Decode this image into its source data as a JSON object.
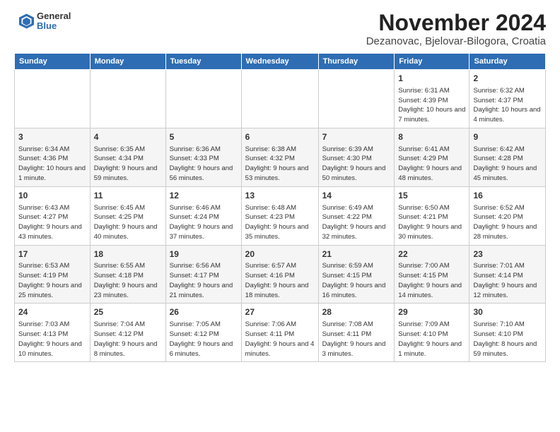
{
  "logo": {
    "line1": "General",
    "line2": "Blue"
  },
  "title": "November 2024",
  "location": "Dezanovac, Bjelovar-Bilogora, Croatia",
  "days_of_week": [
    "Sunday",
    "Monday",
    "Tuesday",
    "Wednesday",
    "Thursday",
    "Friday",
    "Saturday"
  ],
  "weeks": [
    [
      {
        "day": "",
        "text": ""
      },
      {
        "day": "",
        "text": ""
      },
      {
        "day": "",
        "text": ""
      },
      {
        "day": "",
        "text": ""
      },
      {
        "day": "",
        "text": ""
      },
      {
        "day": "1",
        "text": "Sunrise: 6:31 AM\nSunset: 4:39 PM\nDaylight: 10 hours and 7 minutes."
      },
      {
        "day": "2",
        "text": "Sunrise: 6:32 AM\nSunset: 4:37 PM\nDaylight: 10 hours and 4 minutes."
      }
    ],
    [
      {
        "day": "3",
        "text": "Sunrise: 6:34 AM\nSunset: 4:36 PM\nDaylight: 10 hours and 1 minute."
      },
      {
        "day": "4",
        "text": "Sunrise: 6:35 AM\nSunset: 4:34 PM\nDaylight: 9 hours and 59 minutes."
      },
      {
        "day": "5",
        "text": "Sunrise: 6:36 AM\nSunset: 4:33 PM\nDaylight: 9 hours and 56 minutes."
      },
      {
        "day": "6",
        "text": "Sunrise: 6:38 AM\nSunset: 4:32 PM\nDaylight: 9 hours and 53 minutes."
      },
      {
        "day": "7",
        "text": "Sunrise: 6:39 AM\nSunset: 4:30 PM\nDaylight: 9 hours and 50 minutes."
      },
      {
        "day": "8",
        "text": "Sunrise: 6:41 AM\nSunset: 4:29 PM\nDaylight: 9 hours and 48 minutes."
      },
      {
        "day": "9",
        "text": "Sunrise: 6:42 AM\nSunset: 4:28 PM\nDaylight: 9 hours and 45 minutes."
      }
    ],
    [
      {
        "day": "10",
        "text": "Sunrise: 6:43 AM\nSunset: 4:27 PM\nDaylight: 9 hours and 43 minutes."
      },
      {
        "day": "11",
        "text": "Sunrise: 6:45 AM\nSunset: 4:25 PM\nDaylight: 9 hours and 40 minutes."
      },
      {
        "day": "12",
        "text": "Sunrise: 6:46 AM\nSunset: 4:24 PM\nDaylight: 9 hours and 37 minutes."
      },
      {
        "day": "13",
        "text": "Sunrise: 6:48 AM\nSunset: 4:23 PM\nDaylight: 9 hours and 35 minutes."
      },
      {
        "day": "14",
        "text": "Sunrise: 6:49 AM\nSunset: 4:22 PM\nDaylight: 9 hours and 32 minutes."
      },
      {
        "day": "15",
        "text": "Sunrise: 6:50 AM\nSunset: 4:21 PM\nDaylight: 9 hours and 30 minutes."
      },
      {
        "day": "16",
        "text": "Sunrise: 6:52 AM\nSunset: 4:20 PM\nDaylight: 9 hours and 28 minutes."
      }
    ],
    [
      {
        "day": "17",
        "text": "Sunrise: 6:53 AM\nSunset: 4:19 PM\nDaylight: 9 hours and 25 minutes."
      },
      {
        "day": "18",
        "text": "Sunrise: 6:55 AM\nSunset: 4:18 PM\nDaylight: 9 hours and 23 minutes."
      },
      {
        "day": "19",
        "text": "Sunrise: 6:56 AM\nSunset: 4:17 PM\nDaylight: 9 hours and 21 minutes."
      },
      {
        "day": "20",
        "text": "Sunrise: 6:57 AM\nSunset: 4:16 PM\nDaylight: 9 hours and 18 minutes."
      },
      {
        "day": "21",
        "text": "Sunrise: 6:59 AM\nSunset: 4:15 PM\nDaylight: 9 hours and 16 minutes."
      },
      {
        "day": "22",
        "text": "Sunrise: 7:00 AM\nSunset: 4:15 PM\nDaylight: 9 hours and 14 minutes."
      },
      {
        "day": "23",
        "text": "Sunrise: 7:01 AM\nSunset: 4:14 PM\nDaylight: 9 hours and 12 minutes."
      }
    ],
    [
      {
        "day": "24",
        "text": "Sunrise: 7:03 AM\nSunset: 4:13 PM\nDaylight: 9 hours and 10 minutes."
      },
      {
        "day": "25",
        "text": "Sunrise: 7:04 AM\nSunset: 4:12 PM\nDaylight: 9 hours and 8 minutes."
      },
      {
        "day": "26",
        "text": "Sunrise: 7:05 AM\nSunset: 4:12 PM\nDaylight: 9 hours and 6 minutes."
      },
      {
        "day": "27",
        "text": "Sunrise: 7:06 AM\nSunset: 4:11 PM\nDaylight: 9 hours and 4 minutes."
      },
      {
        "day": "28",
        "text": "Sunrise: 7:08 AM\nSunset: 4:11 PM\nDaylight: 9 hours and 3 minutes."
      },
      {
        "day": "29",
        "text": "Sunrise: 7:09 AM\nSunset: 4:10 PM\nDaylight: 9 hours and 1 minute."
      },
      {
        "day": "30",
        "text": "Sunrise: 7:10 AM\nSunset: 4:10 PM\nDaylight: 8 hours and 59 minutes."
      }
    ]
  ]
}
